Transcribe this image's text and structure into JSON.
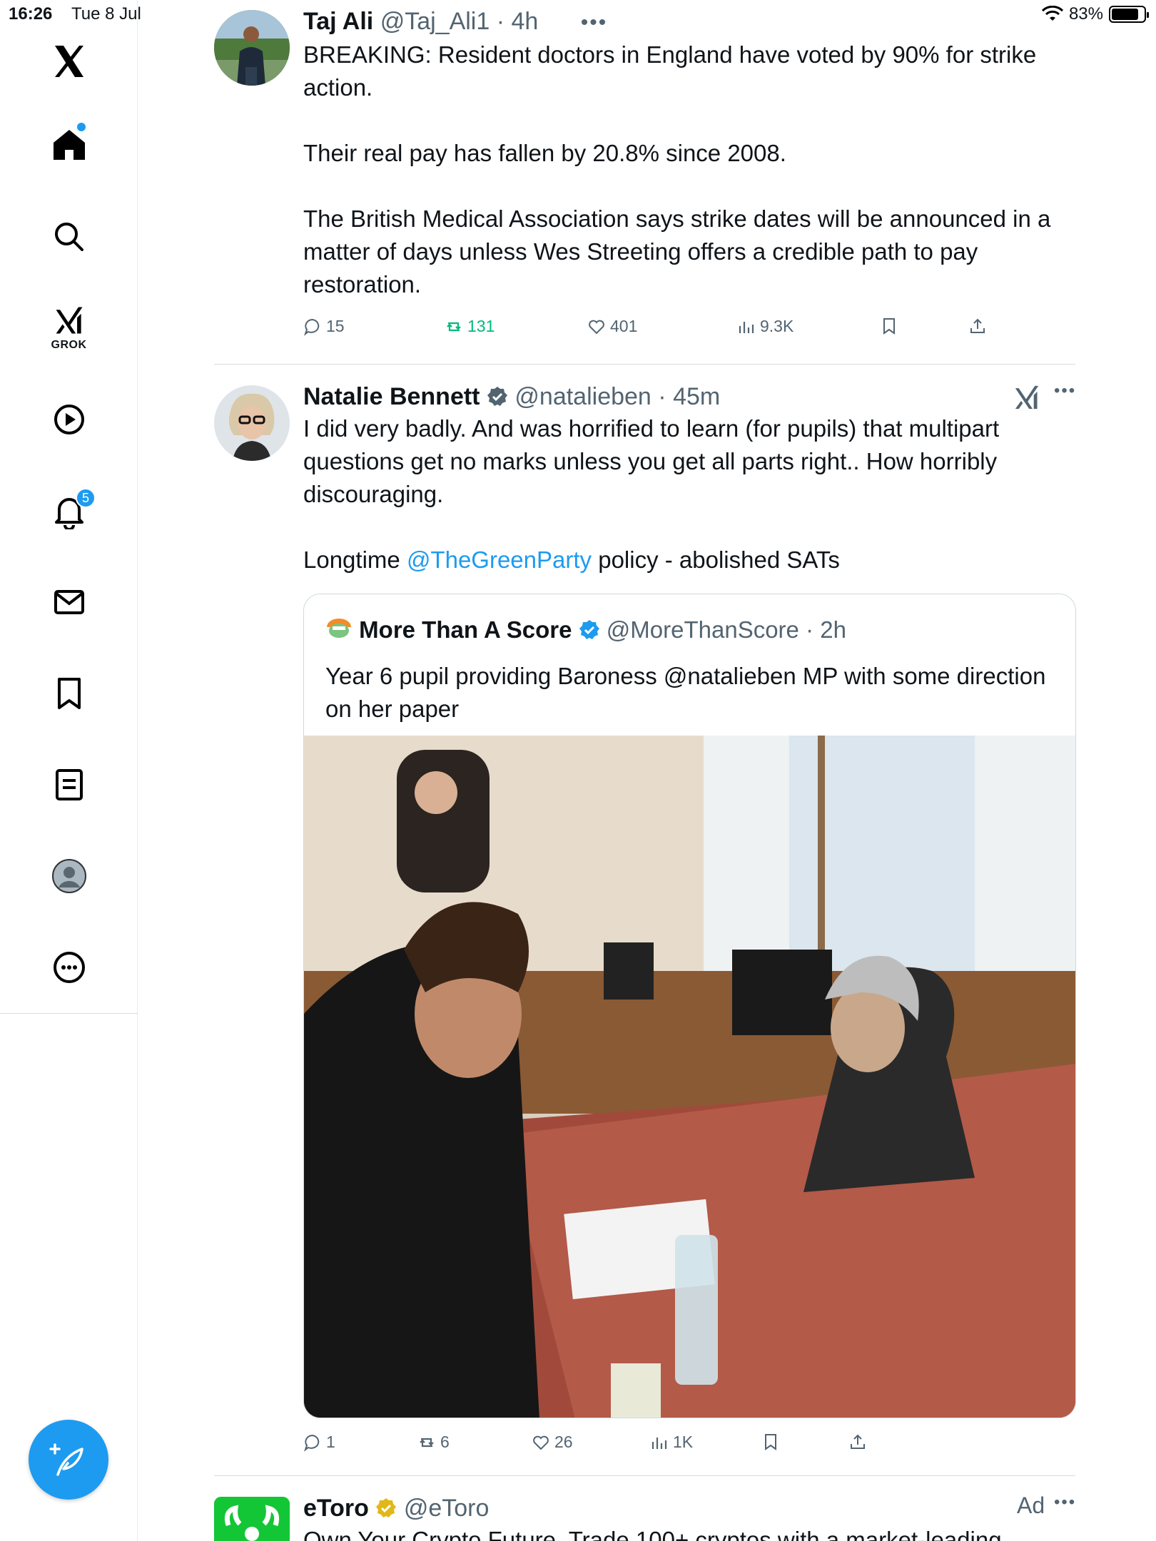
{
  "status_bar": {
    "time": "16:26",
    "date": "Tue 8 Jul",
    "battery": "83%",
    "battery_level": 0.83
  },
  "sidebar": {
    "grok_label": "GROK",
    "notifications_badge": "5"
  },
  "tweets": [
    {
      "name": "Taj Ali",
      "handle": "@Taj_Ali1",
      "time": "· 4h",
      "text": [
        "BREAKING: Resident doctors in England have voted by 90% for strike action.",
        "",
        "Their real pay has fallen by 20.8% since 2008.",
        "",
        "The British Medical Association says strike dates will be announced in a matter of days unless Wes Streeting offers a credible path to pay restoration."
      ],
      "replies": "15",
      "reposts": "131",
      "likes": "401",
      "views": "9.3K"
    },
    {
      "name": "Natalie Bennett",
      "handle": "@natalieben",
      "time": "· 45m",
      "text_1": "I did very badly. And was horrified to learn (for pupils) that multipart questions get no marks unless you get all parts right.. How horribly discouraging.",
      "text_2_pre": "Longtime ",
      "text_2_link": "@TheGreenParty",
      "text_2_post": " policy - abolished SATs",
      "quote": {
        "name": "More Than A Score",
        "handle": "@MoreThanScore",
        "time": "· 2h",
        "text": "Year 6 pupil providing Baroness @natalieben MP with some direction on her paper"
      },
      "replies": "1",
      "reposts": "6",
      "likes": "26",
      "views": "1K"
    },
    {
      "name": "eToro",
      "handle": "@eToro",
      "ad_label": "Ad",
      "text": "Own Your Crypto Future. Trade 100+ cryptos with a market-leading"
    }
  ],
  "colors": {
    "accent": "#1d9bf0",
    "repost_green": "#00ba7c",
    "muted": "#536471",
    "etoro_green": "#13c636",
    "gold_badge": "#e2b719"
  }
}
